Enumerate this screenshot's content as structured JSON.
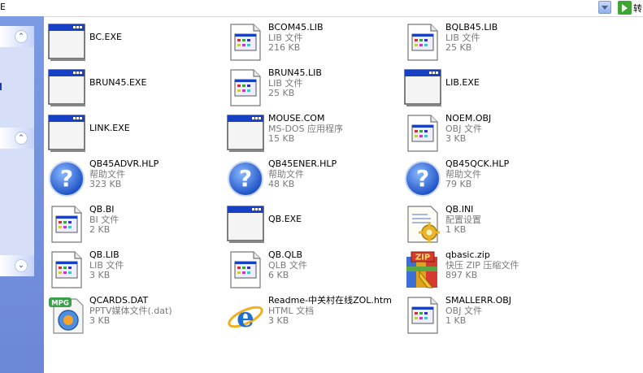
{
  "address": {
    "text": "E",
    "go_label": "转"
  },
  "sidebar": {
    "collapse1": "⌃",
    "collapse2": "⌃",
    "collapse3": "⌄"
  },
  "files": [
    {
      "name": "BC.EXE",
      "type": "",
      "size": "",
      "icon": "exe-window-icon"
    },
    {
      "name": "BCOM45.LIB",
      "type": "LIB 文件",
      "size": "216 KB",
      "icon": "generic-file-icon"
    },
    {
      "name": "BQLB45.LIB",
      "type": "LIB 文件",
      "size": "25 KB",
      "icon": "generic-file-icon"
    },
    {
      "name": "BRUN45.EXE",
      "type": "",
      "size": "",
      "icon": "exe-window-icon"
    },
    {
      "name": "BRUN45.LIB",
      "type": "LIB 文件",
      "size": "25 KB",
      "icon": "generic-file-icon"
    },
    {
      "name": "LIB.EXE",
      "type": "",
      "size": "",
      "icon": "exe-window-icon"
    },
    {
      "name": "LINK.EXE",
      "type": "",
      "size": "",
      "icon": "exe-window-icon"
    },
    {
      "name": "MOUSE.COM",
      "type": "MS-DOS 应用程序",
      "size": "15 KB",
      "icon": "exe-window-icon"
    },
    {
      "name": "NOEM.OBJ",
      "type": "OBJ 文件",
      "size": "3 KB",
      "icon": "generic-file-icon"
    },
    {
      "name": "QB45ADVR.HLP",
      "type": "帮助文件",
      "size": "323 KB",
      "icon": "help-icon"
    },
    {
      "name": "QB45ENER.HLP",
      "type": "帮助文件",
      "size": "48 KB",
      "icon": "help-icon"
    },
    {
      "name": "QB45QCK.HLP",
      "type": "帮助文件",
      "size": "79 KB",
      "icon": "help-icon"
    },
    {
      "name": "QB.BI",
      "type": "BI 文件",
      "size": "2 KB",
      "icon": "generic-file-icon"
    },
    {
      "name": "QB.EXE",
      "type": "",
      "size": "",
      "icon": "exe-window-icon"
    },
    {
      "name": "QB.INI",
      "type": "配置设置",
      "size": "1 KB",
      "icon": "ini-settings-icon"
    },
    {
      "name": "QB.LIB",
      "type": "LIB 文件",
      "size": "3 KB",
      "icon": "generic-file-icon"
    },
    {
      "name": "QB.QLB",
      "type": "QLB 文件",
      "size": "6 KB",
      "icon": "generic-file-icon"
    },
    {
      "name": "qbasic.zip",
      "type": "快压 ZIP 压缩文件",
      "size": "897 KB",
      "icon": "zip-archive-icon"
    },
    {
      "name": "QCARDS.DAT",
      "type": "PPTV媒体文件(.dat)",
      "size": "3 KB",
      "icon": "mpg-media-icon"
    },
    {
      "name": "Readme-中关村在线ZOL.htm",
      "type": "HTML 文档",
      "size": "3 KB",
      "icon": "ie-html-icon"
    },
    {
      "name": "SMALLERR.OBJ",
      "type": "OBJ 文件",
      "size": "1 KB",
      "icon": "generic-file-icon"
    }
  ]
}
